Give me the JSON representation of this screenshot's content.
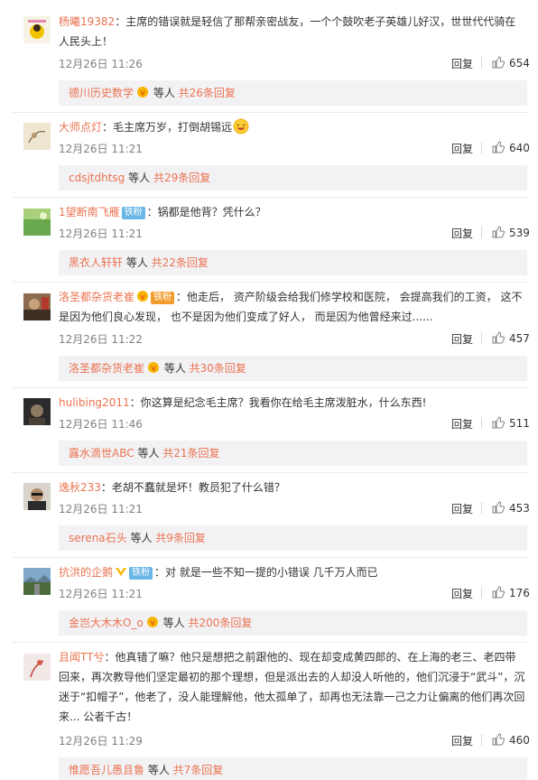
{
  "comments": [
    {
      "username": "杨曦19382",
      "text": "：主席的错误就是轻信了那帮亲密战友，一个个鼓吹老子英雄儿好汉，世世代代骑在人民头上！",
      "time": "12月26日 11:26",
      "reply_label": "回复",
      "likes": "654",
      "thread": {
        "name": "德川历史数学",
        "suffix": " 等人 ",
        "count": "共26条回复"
      }
    },
    {
      "username": "大师点灯",
      "text": "：毛主席万岁，打倒胡锡远",
      "time": "12月26日 11:21",
      "reply_label": "回复",
      "likes": "640",
      "thread": {
        "name": "cdsjtdhtsg",
        "suffix": " 等人 ",
        "count": "共29条回复"
      }
    },
    {
      "username": "1望断南飞雁",
      "fan_badge": "铁粉",
      "text": "：锅都是他背？凭什么？",
      "time": "12月26日 11:21",
      "reply_label": "回复",
      "likes": "539",
      "thread": {
        "name": "黑衣人轩轩",
        "suffix": " 等人 ",
        "count": "共22条回复"
      }
    },
    {
      "username": "洛圣都杂货老崔",
      "fan_badge": "铁粉",
      "text": "：他走后， 资产阶级会给我们修学校和医院， 会提高我们的工资， 这不是因为他们良心发现， 也不是因为他们变成了好人， 而是因为他曾经来过......",
      "time": "12月26日 11:22",
      "reply_label": "回复",
      "likes": "457",
      "thread": {
        "name": "洛圣都杂货老崔",
        "suffix": " 等人 ",
        "count": "共30条回复"
      }
    },
    {
      "username": "hulibing2011",
      "text": "：你这算是纪念毛主席？我看你在给毛主席泼脏水，什么东西!",
      "time": "12月26日 11:46",
      "reply_label": "回复",
      "likes": "511",
      "thread": {
        "name": "露水滴世ABC",
        "suffix": " 等人 ",
        "count": "共21条回复"
      }
    },
    {
      "username": "逸秋233",
      "text": "：老胡不蠢就是坏！教员犯了什么错？",
      "time": "12月26日 11:21",
      "reply_label": "回复",
      "likes": "453",
      "thread": {
        "name": "serena石头",
        "suffix": " 等人 ",
        "count": "共9条回复"
      }
    },
    {
      "username": "抗洪的企鹅",
      "fan_badge": "铁粉",
      "text": "：对 就是一些不知一提的小错误 几千万人而已",
      "time": "12月26日 11:21",
      "reply_label": "回复",
      "likes": "176",
      "thread": {
        "name": "金岂大木木O_o",
        "suffix": " 等人 ",
        "count": "共200条回复"
      }
    },
    {
      "username": "且闻TT兮",
      "text": "：他真错了嘛？他只是想把之前跟他的、现在却变成黄四郎的、在上海的老三、老四带回来，再次教导他们坚定最初的那个理想，但是派出去的人却没人听他的，他们沉浸于“武斗”，沉迷于“扣帽子”，他老了，没人能理解他，他太孤单了，却再也无法靠一己之力让偏离的他们再次回来... 公者千古！",
      "time": "12月26日 11:29",
      "reply_label": "回复",
      "likes": "460",
      "thread": {
        "name": "惟愿吾儿愚且鲁",
        "suffix": " 等人 ",
        "count": "共7条回复"
      }
    }
  ],
  "colors": {
    "username": "#eb7350",
    "text": "#333333",
    "meta": "#808080",
    "thread_bg": "#f2f2f5",
    "fan_blue": "#68b5e6",
    "fan_orange": "#f29c30"
  }
}
